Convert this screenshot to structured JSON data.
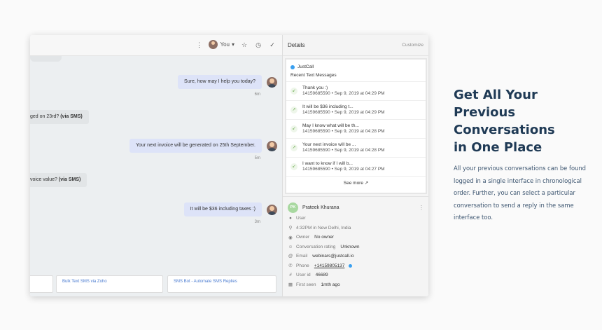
{
  "app": {
    "toolbar": {
      "user_label": "You",
      "caret": "▾",
      "icons": [
        "more-vertical-icon",
        "star-icon",
        "clock-icon",
        "check-icon"
      ]
    },
    "chat": {
      "messages": [
        {
          "direction": "out",
          "text": "Sure, how may I help you today?",
          "time": "6m"
        },
        {
          "direction": "in",
          "text": "ged on 23rd?",
          "channel": "(via SMS)"
        },
        {
          "direction": "out",
          "text": "Your next invoice will be generated on 25th September.",
          "time": "5m"
        },
        {
          "direction": "in",
          "text": "voice value?",
          "channel": "(via SMS)"
        },
        {
          "direction": "out",
          "text": "It will be $36 including taxes :)",
          "time": "3m"
        }
      ],
      "cards": [
        "Bulk Text SMS via Zoho",
        "SMS Bot - Automate SMS Replies"
      ]
    },
    "details": {
      "title": "Details",
      "customize": "Customize",
      "justcall": {
        "name": "JustCall",
        "subtitle": "Recent Text Messages",
        "messages": [
          {
            "text": "Thank you :)",
            "meta": "14159685590 • Sep 9, 2019 at 04:29 PM",
            "direction": "in"
          },
          {
            "text": "It will be $36 including t...",
            "meta": "14159685590 • Sep 9, 2019 at 04:29 PM",
            "direction": "out"
          },
          {
            "text": "May I know what will be th...",
            "meta": "14159685590 • Sep 9, 2019 at 04:28 PM",
            "direction": "in"
          },
          {
            "text": "Your next invoice will be ...",
            "meta": "14159685590 • Sep 9, 2019 at 04:28 PM",
            "direction": "out"
          },
          {
            "text": "I want to know if I will b...",
            "meta": "14159685590 • Sep 9, 2019 at 04:27 PM",
            "direction": "in"
          }
        ],
        "see_more": "See more ↗"
      },
      "contact": {
        "initials": "PK",
        "name": "Prateek Khurana",
        "role": "User",
        "location": "4:32PM in New Delhi, India",
        "owner_label": "Owner",
        "owner_value": "No owner",
        "rating_label": "Conversation rating",
        "rating_value": "Unknown",
        "email_label": "Email",
        "email_value": "webinars@justcall.io",
        "phone_label": "Phone",
        "phone_value": "+14159805137",
        "userid_label": "User id",
        "userid_value": "46689",
        "firstseen_label": "First seen",
        "firstseen_value": "1mth ago"
      }
    }
  },
  "marketing": {
    "headline": [
      "Get All Your",
      "Previous",
      "Conversations",
      "in One Place"
    ],
    "body": "All your previous conversations can be found logged in a single interface in chronological order. Further, you can select a particular conversation to send a reply in the same interface too."
  }
}
